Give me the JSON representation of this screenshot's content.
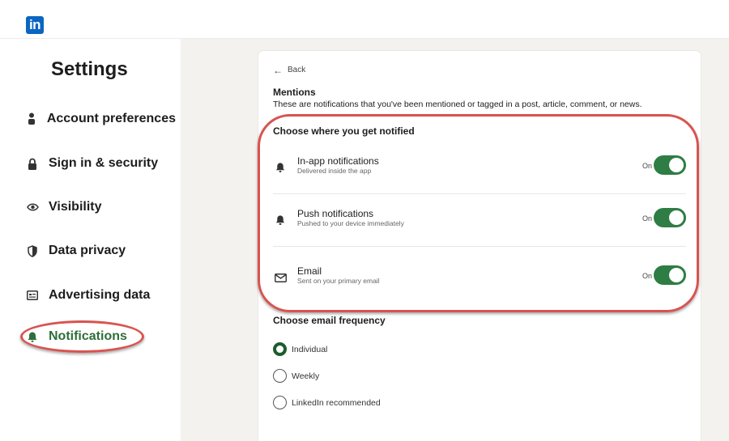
{
  "brand": {
    "logo_text": "in",
    "color": "#0a66c2"
  },
  "sidebar": {
    "title": "Settings",
    "items": [
      {
        "label": "Account preferences",
        "icon": "person-icon"
      },
      {
        "label": "Sign in & security",
        "icon": "lock-icon"
      },
      {
        "label": "Visibility",
        "icon": "eye-icon"
      },
      {
        "label": "Data privacy",
        "icon": "shield-icon"
      },
      {
        "label": "Advertising data",
        "icon": "newspaper-icon"
      },
      {
        "label": "Notifications",
        "icon": "bell-icon",
        "active": true
      }
    ]
  },
  "main": {
    "back_label": "Back",
    "section_title": "Mentions",
    "section_description": "These are notifications that you've been mentioned or tagged in a post, article, comment, or news.",
    "notified_heading": "Choose where you get notified",
    "channels": [
      {
        "title": "In-app notifications",
        "subtitle": "Delivered inside the app",
        "state": "On",
        "enabled": true,
        "icon": "bell-icon"
      },
      {
        "title": "Push notifications",
        "subtitle": "Pushed to your device immediately",
        "state": "On",
        "enabled": true,
        "icon": "bell-icon"
      },
      {
        "title": "Email",
        "subtitle": "Sent on your primary email",
        "state": "On",
        "enabled": true,
        "icon": "envelope-icon"
      }
    ],
    "frequency_heading": "Choose email frequency",
    "frequency_options": [
      {
        "label": "Individual",
        "selected": true
      },
      {
        "label": "Weekly",
        "selected": false
      },
      {
        "label": "LinkedIn recommended",
        "selected": false
      }
    ]
  },
  "colors": {
    "accent_green": "#2e7d44",
    "annotation_red": "#d9534f",
    "background_gray": "#f3f2ef"
  }
}
